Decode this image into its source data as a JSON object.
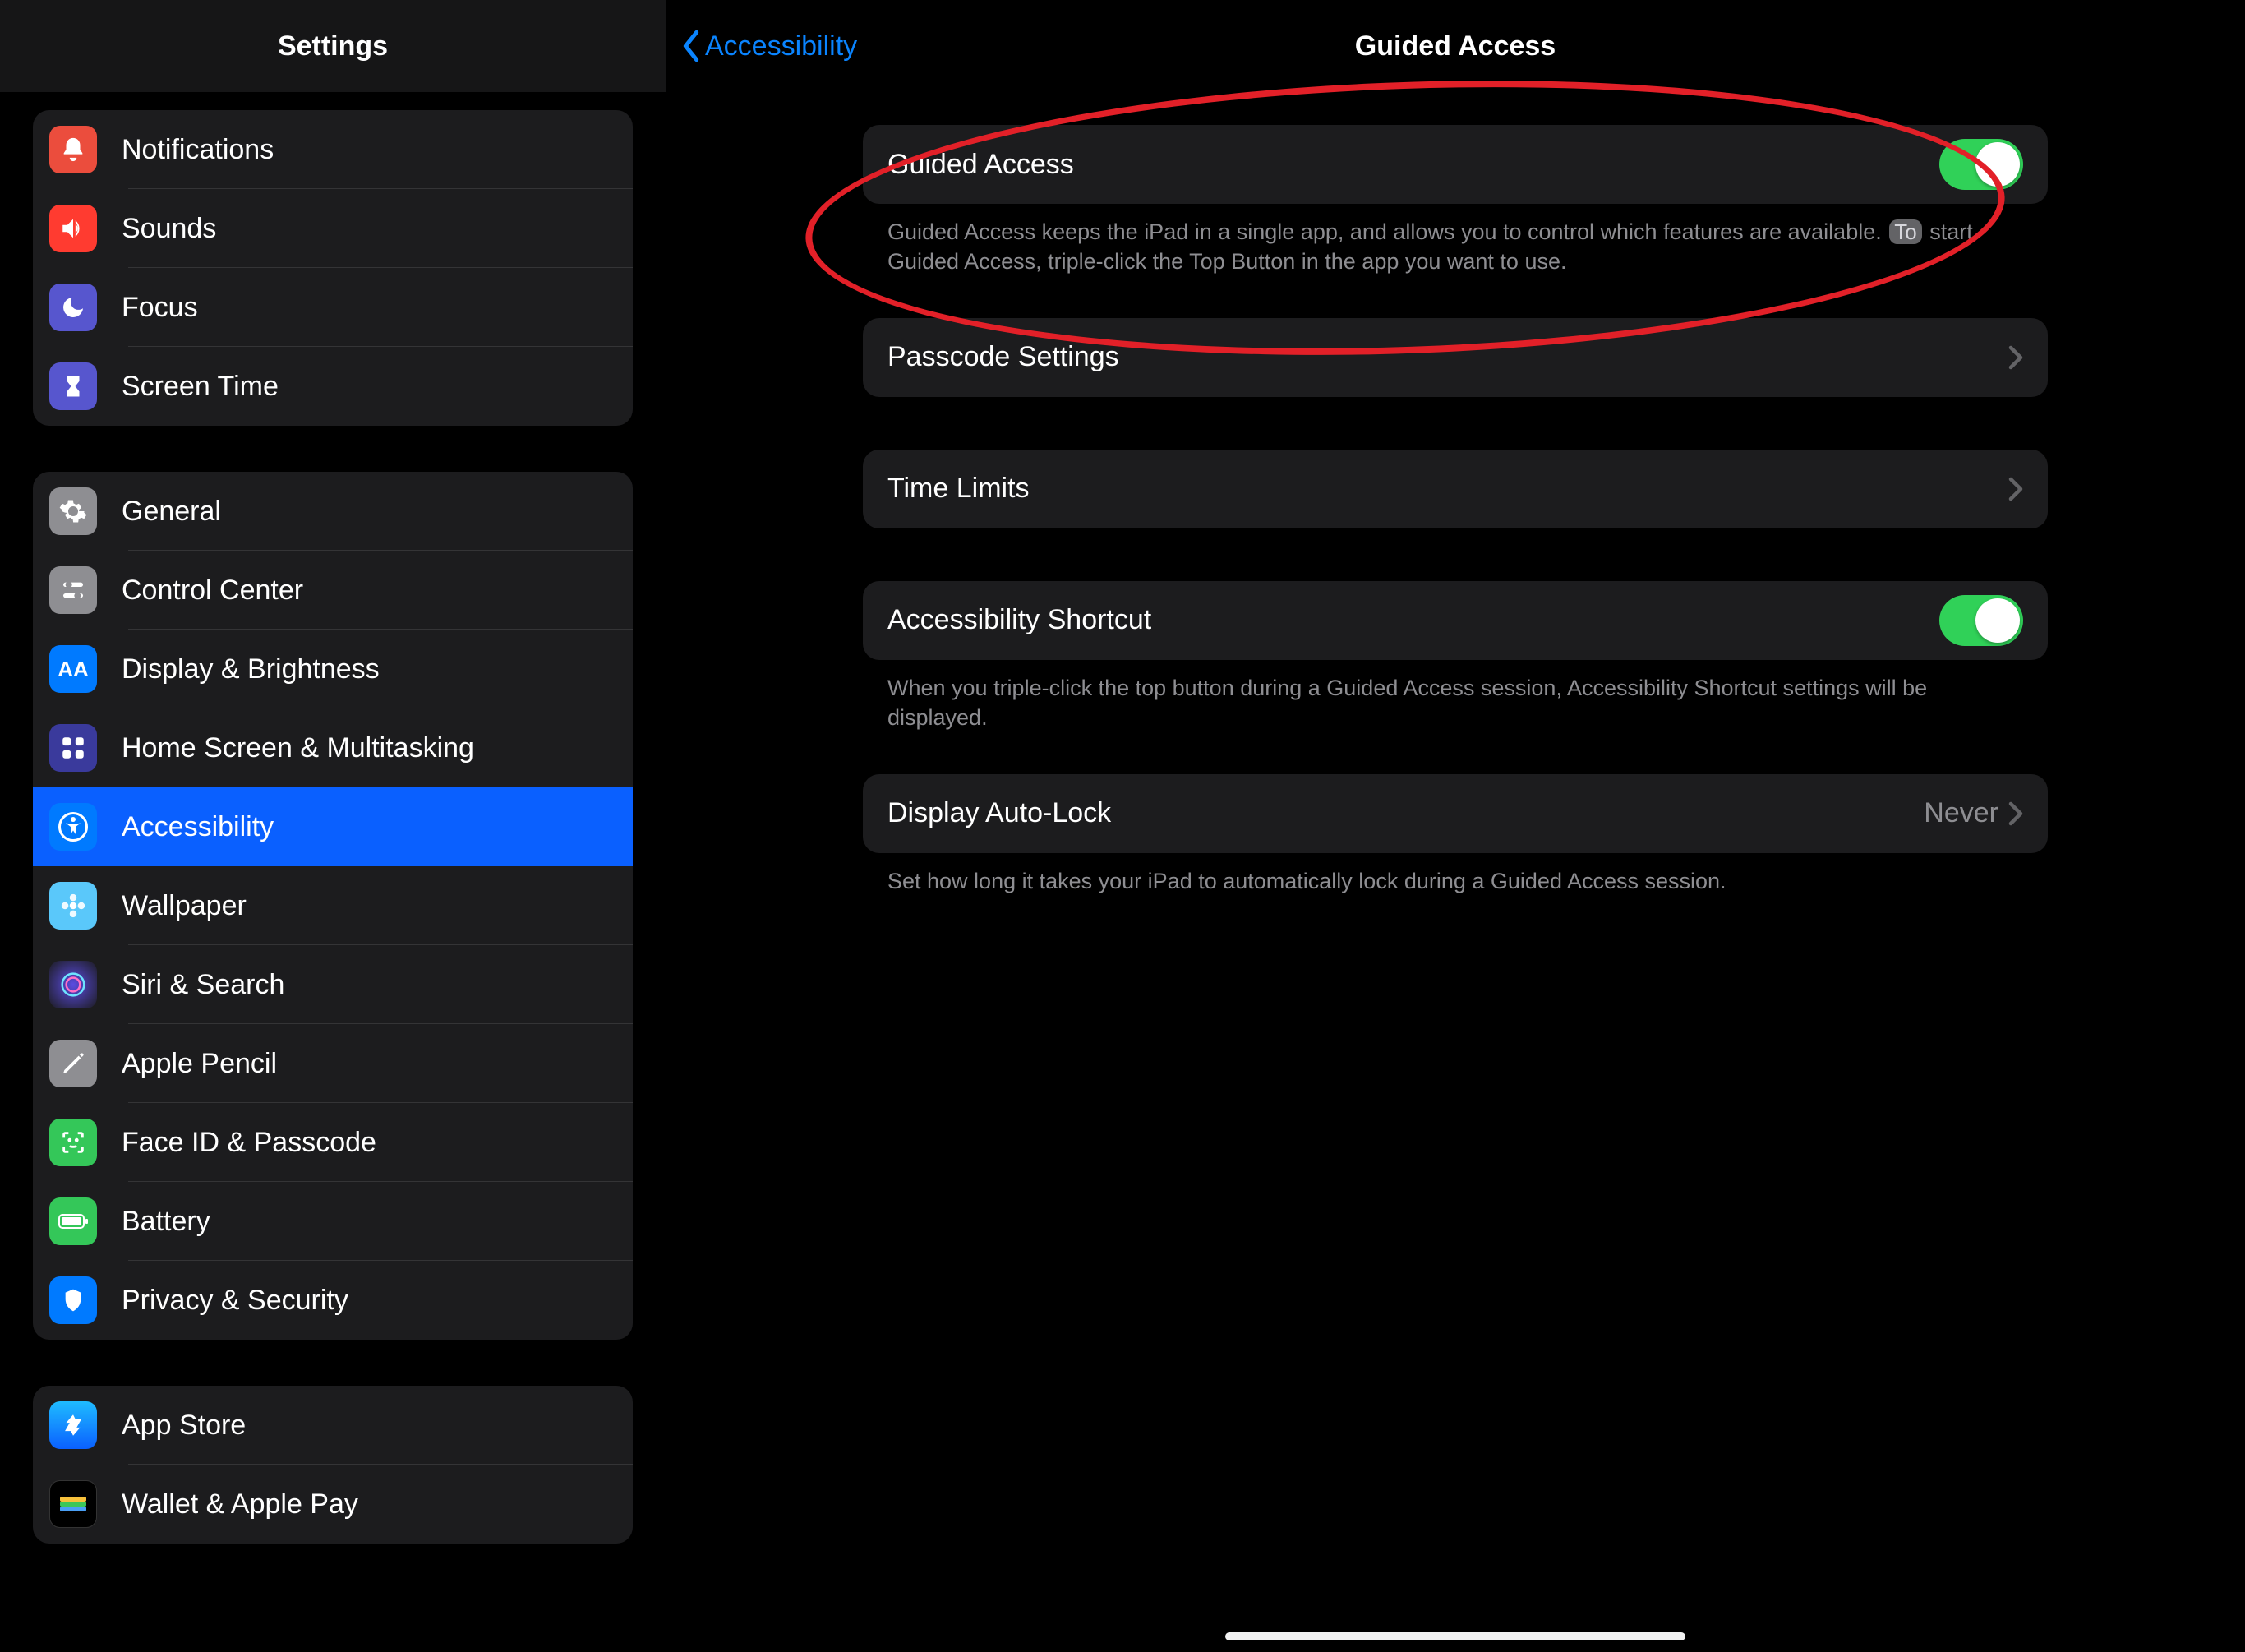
{
  "sidebar": {
    "title": "Settings",
    "groups": [
      {
        "items": [
          {
            "label": "Notifications",
            "icon": "bell-icon",
            "bg": "bg-red"
          },
          {
            "label": "Sounds",
            "icon": "speaker-icon",
            "bg": "bg-speaker"
          },
          {
            "label": "Focus",
            "icon": "moon-icon",
            "bg": "bg-focus"
          },
          {
            "label": "Screen Time",
            "icon": "hourglass-icon",
            "bg": "bg-hg"
          }
        ]
      },
      {
        "items": [
          {
            "label": "General",
            "icon": "gear-icon",
            "bg": "bg-gray"
          },
          {
            "label": "Control Center",
            "icon": "sliders-icon",
            "bg": "bg-gray"
          },
          {
            "label": "Display & Brightness",
            "icon": "aa-icon",
            "bg": "bg-blue"
          },
          {
            "label": "Home Screen & Multitasking",
            "icon": "grid-icon",
            "bg": "bg-blue"
          },
          {
            "label": "Accessibility",
            "icon": "accessibility-icon",
            "bg": "bg-blue",
            "selected": true
          },
          {
            "label": "Wallpaper",
            "icon": "flower-icon",
            "bg": "bg-cyan"
          },
          {
            "label": "Siri & Search",
            "icon": "siri-icon",
            "bg": ""
          },
          {
            "label": "Apple Pencil",
            "icon": "pencil-icon",
            "bg": "bg-gray"
          },
          {
            "label": "Face ID & Passcode",
            "icon": "faceid-icon",
            "bg": "bg-green"
          },
          {
            "label": "Battery",
            "icon": "battery-icon",
            "bg": "bg-green"
          },
          {
            "label": "Privacy & Security",
            "icon": "hand-icon",
            "bg": "bg-blue"
          }
        ]
      },
      {
        "items": [
          {
            "label": "App Store",
            "icon": "appstore-icon",
            "bg": "bg-blue"
          },
          {
            "label": "Wallet & Apple Pay",
            "icon": "wallet-icon",
            "bg": ""
          }
        ]
      }
    ]
  },
  "detail": {
    "back_label": "Accessibility",
    "title": "Guided Access",
    "sections": {
      "guided_access": {
        "label": "Guided Access",
        "on": true,
        "footer_pre": "Guided Access keeps the iPad in a single app, and allows you to control which features are available. ",
        "footer_pill": "To",
        "footer_post": " start Guided Access, triple-click the Top Button in the app you want to use."
      },
      "passcode": {
        "label": "Passcode Settings"
      },
      "time_limits": {
        "label": "Time Limits"
      },
      "shortcut": {
        "label": "Accessibility Shortcut",
        "on": true,
        "footer": "When you triple-click the top button during a Guided Access session, Accessibility Shortcut settings will be displayed."
      },
      "autolock": {
        "label": "Display Auto-Lock",
        "value": "Never",
        "footer": "Set how long it takes your iPad to automatically lock during a Guided Access session."
      }
    }
  },
  "annotation": {
    "highlight": "guided-access-toggle"
  }
}
